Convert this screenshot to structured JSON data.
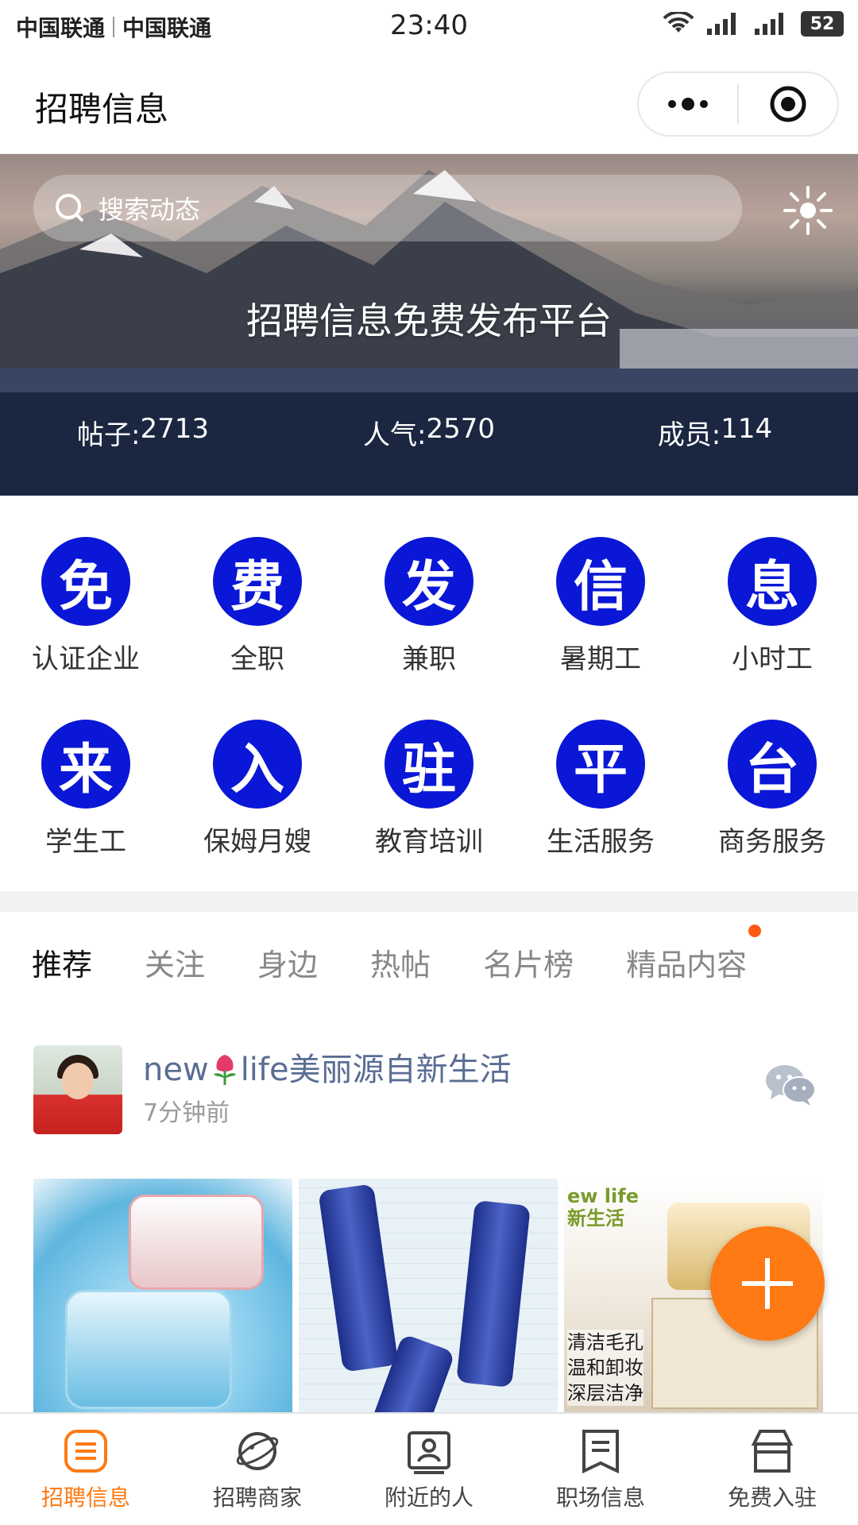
{
  "status_bar": {
    "carrier_1": "中国联通",
    "carrier_2": "中国联通",
    "time": "23:40",
    "battery": "52"
  },
  "header": {
    "title": "招聘信息",
    "menu_icon": "more-dots-icon",
    "close_icon": "target-circle-icon"
  },
  "banner": {
    "search_placeholder": "搜索动态",
    "title": "招聘信息免费发布平台",
    "stats": [
      {
        "label": "帖子:",
        "value": "2713"
      },
      {
        "label": "人气:",
        "value": "2570"
      },
      {
        "label": "成员:",
        "value": "114"
      }
    ]
  },
  "categories": [
    {
      "icon_char": "免",
      "label": "认证企业"
    },
    {
      "icon_char": "费",
      "label": "全职"
    },
    {
      "icon_char": "发",
      "label": "兼职"
    },
    {
      "icon_char": "信",
      "label": "暑期工"
    },
    {
      "icon_char": "息",
      "label": "小时工"
    },
    {
      "icon_char": "来",
      "label": "学生工"
    },
    {
      "icon_char": "入",
      "label": "保姆月嫂"
    },
    {
      "icon_char": "驻",
      "label": "教育培训"
    },
    {
      "icon_char": "平",
      "label": "生活服务"
    },
    {
      "icon_char": "台",
      "label": "商务服务"
    }
  ],
  "feed_tabs": [
    "推荐",
    "关注",
    "身边",
    "热帖",
    "名片榜",
    "精品内容"
  ],
  "post": {
    "name_prefix": "new",
    "name_suffix": "life美丽源自新生活",
    "time": "7分钟前",
    "photo3_brand": "ew life\n新生活",
    "photo3_text": "清洁毛孔\n温和卸妆\n深层洁净"
  },
  "tabbar": [
    {
      "label": "招聘信息",
      "icon": "list-doc-icon"
    },
    {
      "label": "招聘商家",
      "icon": "planet-icon"
    },
    {
      "label": "附近的人",
      "icon": "person-card-icon"
    },
    {
      "label": "职场信息",
      "icon": "bookmark-doc-icon"
    },
    {
      "label": "免费入驻",
      "icon": "store-box-icon"
    }
  ],
  "colors": {
    "accent": "#ff7a14",
    "category_blue": "#0a17d6",
    "link": "#5a6d93"
  }
}
